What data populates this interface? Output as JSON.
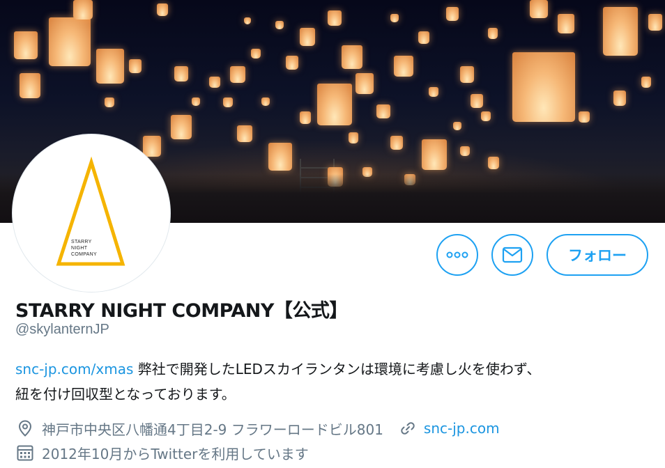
{
  "profile": {
    "name": "STARRY NIGHT COMPANY【公式】",
    "handle": "@skylanternJP",
    "bio_link": "snc-jp.com/xmas",
    "bio_line1": " 弊社で開発したLEDスカイランタンは環境に考慮し火を使わず、",
    "bio_line2": "紐を付け回収型となっております。",
    "location": "神戸市中央区八幡通4丁目2-9 フラワーロードビル801",
    "website": "snc-jp.com",
    "joined": "2012年10月からTwitterを利用しています"
  },
  "avatar": {
    "logo_text": "STARRY\nNIGHT\nCOMPANY",
    "accent": "#f5b400"
  },
  "actions": {
    "follow_label": "フォロー",
    "more_icon": "more-dots-icon",
    "message_icon": "envelope-icon"
  },
  "colors": {
    "accent": "#1da1f2",
    "link": "#1b95e0",
    "secondary_text": "#657786"
  }
}
